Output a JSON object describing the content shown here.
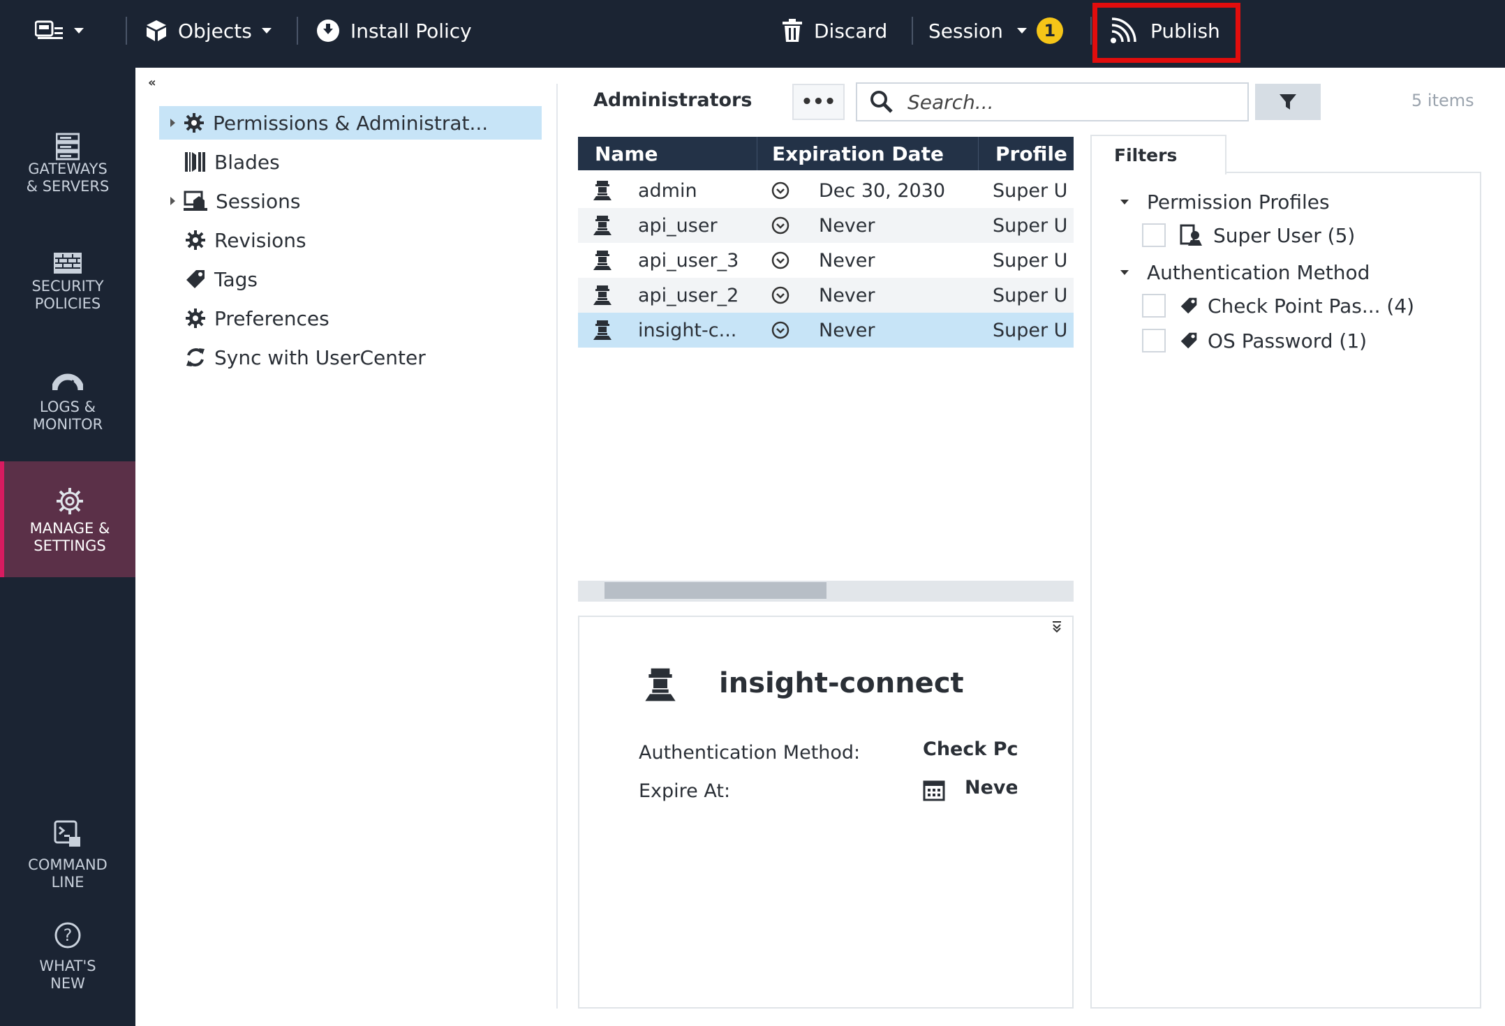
{
  "topbar": {
    "objects_label": "Objects",
    "install_policy_label": "Install Policy",
    "discard_label": "Discard",
    "session_label": "Session",
    "session_badge": "1",
    "publish_label": "Publish"
  },
  "leftnav": {
    "items": [
      {
        "label": "GATEWAYS\n& SERVERS",
        "icon": "server-icon"
      },
      {
        "label": "SECURITY\nPOLICIES",
        "icon": "firewall-icon"
      },
      {
        "label": "LOGS &\nMONITOR",
        "icon": "gauge-icon"
      },
      {
        "label": "MANAGE &\nSETTINGS",
        "icon": "gear-icon"
      },
      {
        "label": "COMMAND\nLINE",
        "icon": "terminal-icon"
      },
      {
        "label": "WHAT'S\nNEW",
        "icon": "question-icon"
      }
    ]
  },
  "tree": {
    "items": [
      {
        "label": "Permissions & Administrat...",
        "icon": "gear-icon"
      },
      {
        "label": "Blades",
        "icon": "blades-icon"
      },
      {
        "label": "Sessions",
        "icon": "sessions-icon"
      },
      {
        "label": "Revisions",
        "icon": "gear-icon"
      },
      {
        "label": "Tags",
        "icon": "tag-icon"
      },
      {
        "label": "Preferences",
        "icon": "gear-icon"
      },
      {
        "label": "Sync with UserCenter",
        "icon": "sync-icon"
      }
    ]
  },
  "admins": {
    "title": "Administrators",
    "more_label": "•••",
    "search_placeholder": "Search...",
    "count": "5 items",
    "columns": [
      "Name",
      "Expiration Date",
      "Profile"
    ],
    "rows": [
      {
        "name": "admin",
        "expiration": "Dec 30, 2030",
        "profile": "Super U"
      },
      {
        "name": "api_user",
        "expiration": "Never",
        "profile": "Super U"
      },
      {
        "name": "api_user_3",
        "expiration": "Never",
        "profile": "Super U"
      },
      {
        "name": "api_user_2",
        "expiration": "Never",
        "profile": "Super U"
      },
      {
        "name": "insight-c...",
        "expiration": "Never",
        "profile": "Super U"
      }
    ]
  },
  "details": {
    "name": "insight-connect",
    "auth_label": "Authentication Method:",
    "auth_value": "Check Pc",
    "expire_label": "Expire At:",
    "expire_value": "Neve"
  },
  "filters": {
    "tab_label": "Filters",
    "group1": "Permission Profiles",
    "group1_items": [
      "Super User (5)"
    ],
    "group2": "Authentication Method",
    "group2_items": [
      "Check Point Pas... (4)",
      "OS Password (1)"
    ]
  },
  "colors": {
    "nav_bg": "#1b2433",
    "active_nav": "#5b3048",
    "active_accent": "#d81b60",
    "selection": "#c7e4f7",
    "publish_highlight": "#e10d0d",
    "badge": "#f5c518"
  }
}
